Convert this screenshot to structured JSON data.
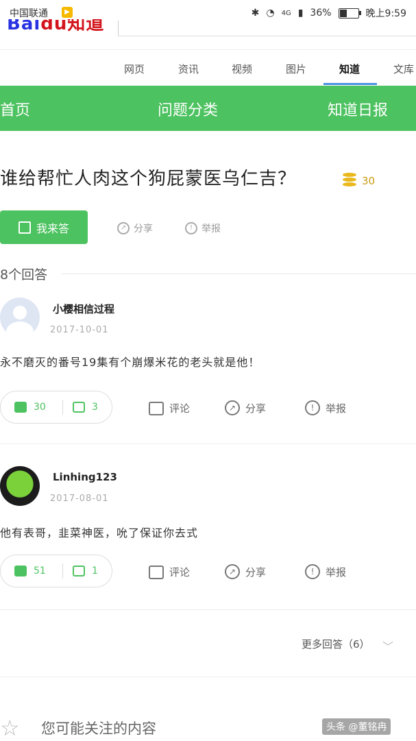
{
  "status_bar": {
    "carrier": "中国联通",
    "network": "4G",
    "battery_percent": "36%",
    "battery_level": 0.36,
    "time": "晚上9:59"
  },
  "nav": {
    "tabs": [
      "网页",
      "资讯",
      "视频",
      "图片",
      "知道",
      "文库"
    ],
    "active": "知道"
  },
  "green_bar": {
    "items": [
      "首页",
      "问题分类",
      "知道日报"
    ]
  },
  "question": {
    "title": "谁给帮忙人肉这个狗屁蒙医乌仁吉？",
    "bounty": "30",
    "answer_button": "我来答",
    "share": "分享",
    "report": "举报"
  },
  "answer_count": "8个回答",
  "answers": [
    {
      "username": "小樱相信过程",
      "date": "2017-10-01",
      "content": "永不磨灭的番号19集有个崩爆米花的老头就是他！",
      "upvotes": "30",
      "downvotes": "3",
      "comment": "评论",
      "share": "分享",
      "report": "举报"
    },
    {
      "username": "Linhing123",
      "date": "2017-08-01",
      "content": "他有表哥，韭菜神医，吮了保证你去式",
      "upvotes": "51",
      "downvotes": "1",
      "comment": "评论",
      "share": "分享",
      "report": "举报"
    }
  ],
  "more_answers": "更多回答（6）",
  "related_title": "您可能关注的内容",
  "watermark": "头条 @董铭冉",
  "colors": {
    "green": "#4dc260",
    "blue_underline": "#4a90e2",
    "coin": "#e9b81c"
  }
}
